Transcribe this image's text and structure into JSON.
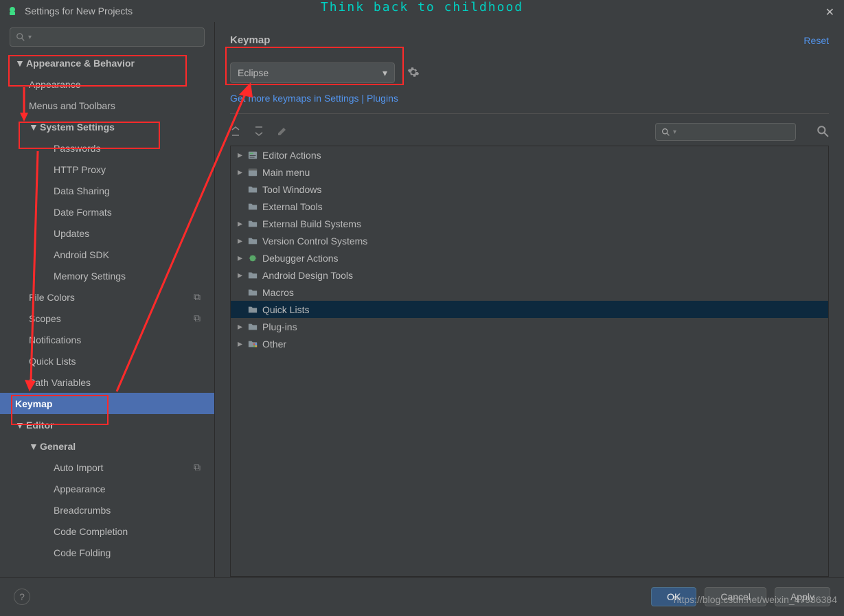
{
  "window": {
    "title": "Settings for New Projects",
    "tagline": "Think back to childhood"
  },
  "sidebar": {
    "items": [
      {
        "label": "Appearance & Behavior",
        "lv": 0,
        "arrow": "▼"
      },
      {
        "label": "Appearance",
        "lv": 1
      },
      {
        "label": "Menus and Toolbars",
        "lv": 1
      },
      {
        "label": "System Settings",
        "lv": 1,
        "arrow": "▼",
        "hasarrow": true
      },
      {
        "label": "Passwords",
        "lv": 2
      },
      {
        "label": "HTTP Proxy",
        "lv": 2
      },
      {
        "label": "Data Sharing",
        "lv": 2
      },
      {
        "label": "Date Formats",
        "lv": 2
      },
      {
        "label": "Updates",
        "lv": 2
      },
      {
        "label": "Android SDK",
        "lv": 2
      },
      {
        "label": "Memory Settings",
        "lv": 2
      },
      {
        "label": "File Colors",
        "lv": 1,
        "badge": "⧉"
      },
      {
        "label": "Scopes",
        "lv": 1,
        "badge": "⧉"
      },
      {
        "label": "Notifications",
        "lv": 1
      },
      {
        "label": "Quick Lists",
        "lv": 1
      },
      {
        "label": "Path Variables",
        "lv": 1
      },
      {
        "label": "Keymap",
        "lv": 0,
        "selected": true,
        "noarrow": true
      },
      {
        "label": "Editor",
        "lv": 0,
        "arrow": "▼"
      },
      {
        "label": "General",
        "lv": 1,
        "arrow": "▼",
        "hasarrow": true
      },
      {
        "label": "Auto Import",
        "lv": 2,
        "badge": "⧉"
      },
      {
        "label": "Appearance",
        "lv": 2
      },
      {
        "label": "Breadcrumbs",
        "lv": 2
      },
      {
        "label": "Code Completion",
        "lv": 2
      },
      {
        "label": "Code Folding",
        "lv": 2
      }
    ]
  },
  "main": {
    "title": "Keymap",
    "reset": "Reset",
    "dropdown": "Eclipse",
    "link": "Get more keymaps in Settings | Plugins",
    "tree": [
      {
        "label": "Editor Actions",
        "arrow": true,
        "icon": "editor"
      },
      {
        "label": "Main menu",
        "arrow": true,
        "icon": "menu"
      },
      {
        "label": "Tool Windows",
        "arrow": false,
        "icon": "folder"
      },
      {
        "label": "External Tools",
        "arrow": false,
        "icon": "folder-ext"
      },
      {
        "label": "External Build Systems",
        "arrow": true,
        "icon": "folder-gear"
      },
      {
        "label": "Version Control Systems",
        "arrow": true,
        "icon": "folder"
      },
      {
        "label": "Debugger Actions",
        "arrow": true,
        "icon": "bug"
      },
      {
        "label": "Android Design Tools",
        "arrow": true,
        "icon": "folder"
      },
      {
        "label": "Macros",
        "arrow": false,
        "icon": "folder"
      },
      {
        "label": "Quick Lists",
        "arrow": false,
        "icon": "folder",
        "selected": true
      },
      {
        "label": "Plug-ins",
        "arrow": true,
        "icon": "folder"
      },
      {
        "label": "Other",
        "arrow": true,
        "icon": "folder-color"
      }
    ]
  },
  "footer": {
    "ok": "OK",
    "cancel": "Cancel",
    "apply": "Apply"
  },
  "watermark": "https://blog.csdn.net/weixin_47936384"
}
